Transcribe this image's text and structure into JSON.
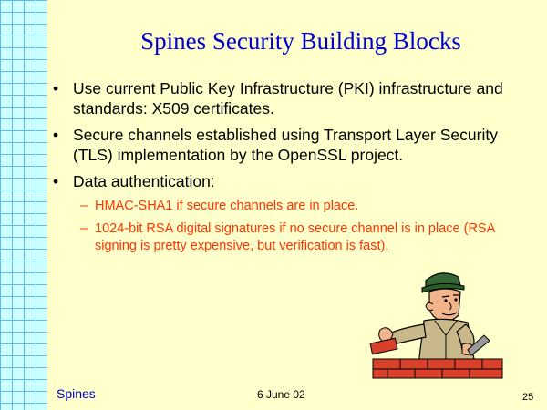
{
  "slide": {
    "title": "Spines Security Building Blocks",
    "bullets": [
      {
        "text": "Use current Public Key Infrastructure (PKI) infrastructure and standards: X509 certificates.",
        "subs": []
      },
      {
        "text": "Secure channels established using Transport Layer Security (TLS) implementation by the OpenSSL project.",
        "subs": []
      },
      {
        "text": "Data authentication:",
        "subs": [
          "HMAC-SHA1 if secure channels are in place.",
          "1024-bit RSA digital signatures if no secure channel is in place (RSA signing is pretty expensive, but verification is fast)."
        ]
      }
    ],
    "bullet_symbol": "•",
    "dash_symbol": "–",
    "colors": {
      "background": "#ffffcc",
      "title": "#0000cc",
      "sub_text": "#ff3300",
      "grid": "#ccffff"
    },
    "icon": "bricklayer-clipart"
  },
  "footer": {
    "left": "Spines",
    "center": "6 June 02",
    "page_number": "25"
  }
}
